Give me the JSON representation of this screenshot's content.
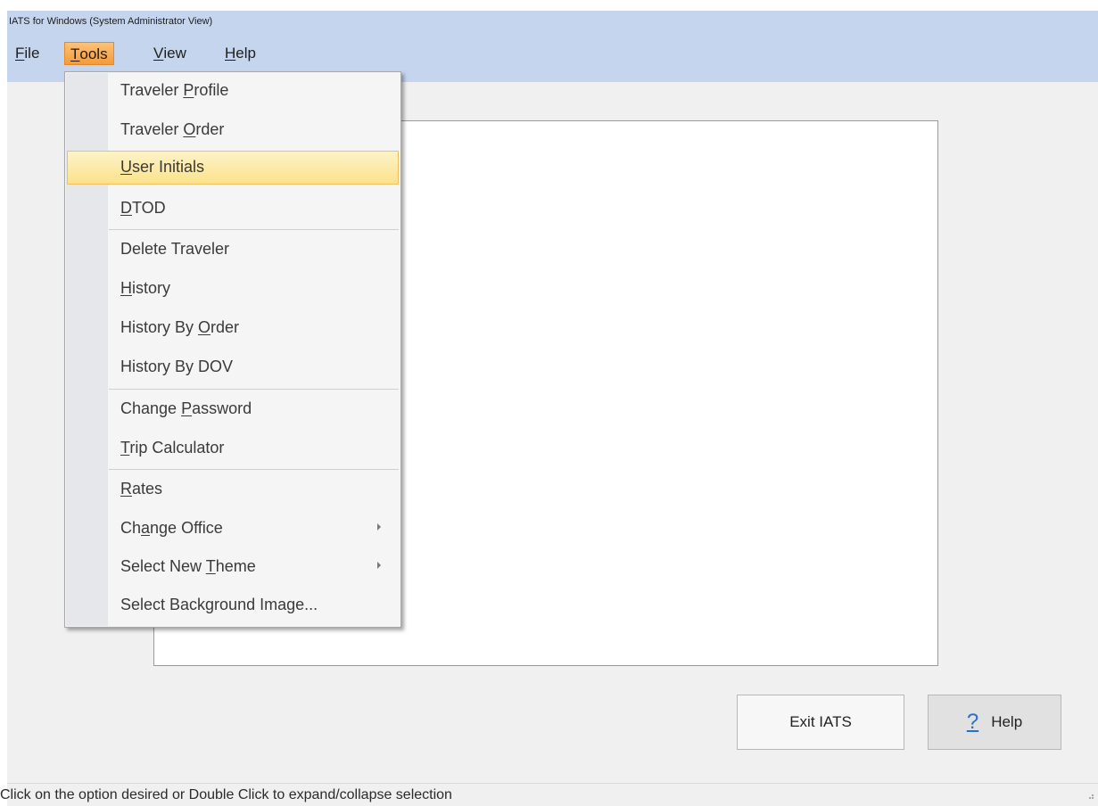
{
  "app": {
    "title": "IATS for Windows (System Administrator View)"
  },
  "menubar": {
    "file": {
      "pre": "",
      "mnemonic": "F",
      "post": "ile"
    },
    "tools": {
      "pre": "",
      "mnemonic": "T",
      "post": "ools"
    },
    "view": {
      "pre": "",
      "mnemonic": "V",
      "post": "iew"
    },
    "help": {
      "pre": "",
      "mnemonic": "H",
      "post": "elp"
    }
  },
  "tools_menu": {
    "items": [
      {
        "pre": "Traveler ",
        "mnemonic": "P",
        "post": "rofile"
      },
      {
        "pre": "Traveler ",
        "mnemonic": "O",
        "post": "rder"
      },
      {
        "pre": "",
        "mnemonic": "U",
        "post": "ser Initials"
      },
      {
        "pre": "",
        "mnemonic": "D",
        "post": "TOD"
      },
      {
        "pre": "Delete Traveler",
        "mnemonic": "",
        "post": ""
      },
      {
        "pre": "",
        "mnemonic": "H",
        "post": "istory"
      },
      {
        "pre": "History By ",
        "mnemonic": "O",
        "post": "rder"
      },
      {
        "pre": "History By DOV",
        "mnemonic": "",
        "post": ""
      },
      {
        "pre": "Change ",
        "mnemonic": "P",
        "post": "assword"
      },
      {
        "pre": "",
        "mnemonic": "T",
        "post": "rip Calculator"
      },
      {
        "pre": "",
        "mnemonic": "R",
        "post": "ates"
      },
      {
        "pre": "Ch",
        "mnemonic": "a",
        "post": "nge Office"
      },
      {
        "pre": "Select New ",
        "mnemonic": "T",
        "post": "heme"
      },
      {
        "pre": "Select Background Image...",
        "mnemonic": "",
        "post": ""
      }
    ],
    "highlighted": "User Initials"
  },
  "buttons": {
    "exit_label": "Exit IATS",
    "help_icon": "?",
    "help_label": "Help"
  },
  "status": {
    "text": "Click on the option desired or Double Click to expand/collapse selection"
  },
  "colors": {
    "titlebar": "#c6d5ee",
    "menu_active": "#f39b3a",
    "item_highlight": "#fbe28a"
  }
}
